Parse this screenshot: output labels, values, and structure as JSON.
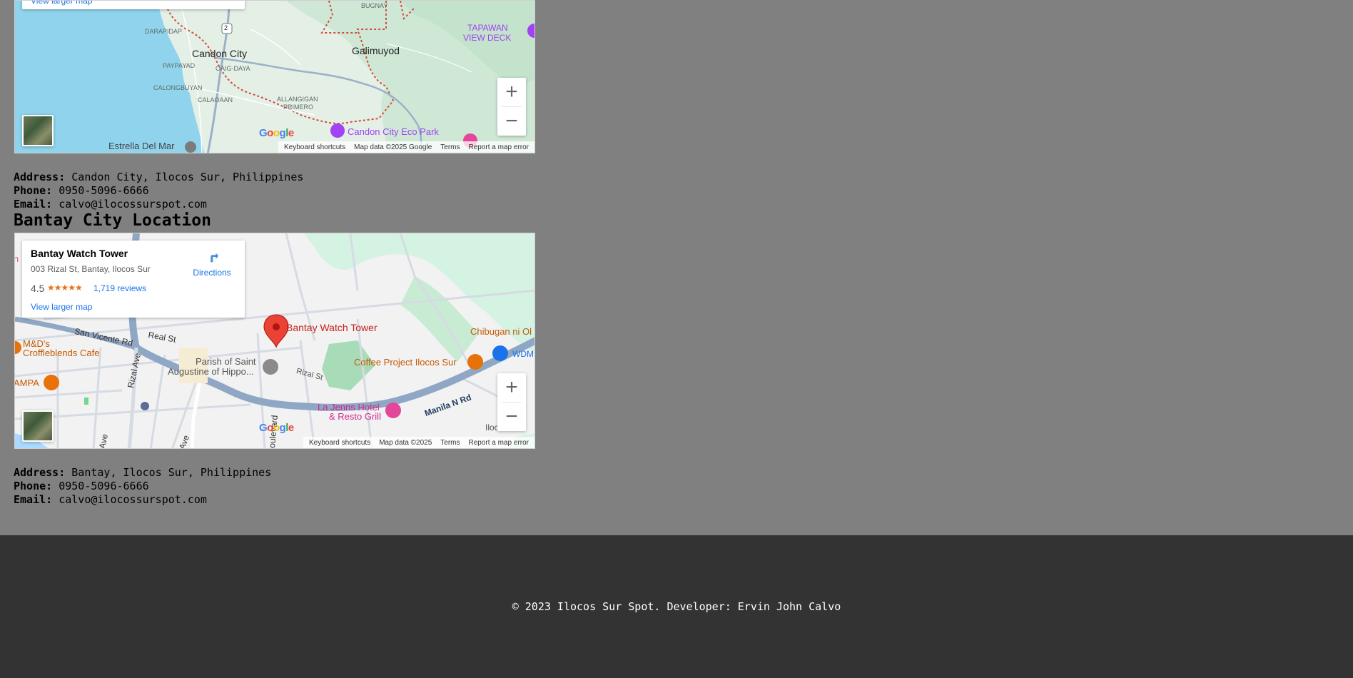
{
  "map1": {
    "larger_map_link": "View larger map",
    "labels": {
      "bugnay": "BUGNAY",
      "darapidap": "DARAPIDAP",
      "candon_city": "Candon City",
      "oaig_daya": "OAIG-DAYA",
      "paypayad": "PAYPAYAD",
      "calongbuyan": "CALONGBUYAN",
      "calaoaan": "CALAOAAN",
      "allangigan": "ALLANGIGAN",
      "primero": "PRIMERO",
      "galimuyod": "Galimuyod",
      "tapawan": "TAPAWAN",
      "view_deck": "VIEW DECK",
      "estrella": "Estrella Del Mar",
      "eco_park": "Candon City Eco Park",
      "route": "2"
    },
    "zoom_in": "+",
    "zoom_out": "−",
    "attribution": {
      "shortcuts": "Keyboard shortcuts",
      "data": "Map data ©2025 Google",
      "terms": "Terms",
      "report": "Report a map error"
    }
  },
  "candon_details": {
    "address_label": "Address:",
    "address_value": "Candon City, Ilocos Sur, Philippines",
    "phone_label": "Phone:",
    "phone_value": "0950-5096-6666",
    "email_label": "Email:",
    "email_value": "calvo@ilocossurspot.com"
  },
  "bantay_section": {
    "title": "Bantay City Location"
  },
  "map2": {
    "place_name": "Bantay Watch Tower",
    "place_address": "003 Rizal St, Bantay, Ilocos Sur",
    "rating": "4.5",
    "stars": "★★★★★",
    "reviews": "1,719 reviews",
    "directions": "Directions",
    "larger_map_link": "View larger map",
    "labels": {
      "pin_label": "Bantay Watch Tower",
      "san_vicente": "San Vicente Rd",
      "real_st": "Real St",
      "md_line1": "M&D's",
      "md_line2": "Croffleblends Cafe",
      "rizal_ave": "Rizal Ave",
      "parish_line1": "Parish of Saint",
      "parish_line2": "Augustine of Hippo...",
      "rizal_st": "Rizal St",
      "coffee_project": "Coffee Project Ilocos Sur",
      "chibugan": "Chibugan ni Ol",
      "wdm": "WDM",
      "ampa": "AMPA",
      "la_jenns1": "La Jenns Hotel",
      "la_jenns2": "& Resto Grill",
      "manila_rd": "Manila N Rd",
      "ilocos": "Ilocos",
      "ave1": "Ave",
      "ave2": "Ave",
      "oulevard": "oulevard",
      "n_edge": "n"
    },
    "zoom_in": "+",
    "zoom_out": "−",
    "attribution": {
      "shortcuts": "Keyboard shortcuts",
      "data": "Map data ©2025",
      "terms": "Terms",
      "report": "Report a map error"
    }
  },
  "bantay_details": {
    "address_label": "Address:",
    "address_value": "Bantay, Ilocos Sur, Philippines",
    "phone_label": "Phone:",
    "phone_value": "0950-5096-6666",
    "email_label": "Email:",
    "email_value": "calvo@ilocossurspot.com"
  },
  "footer": {
    "text": "© 2023 Ilocos Sur Spot. Developer: Ervin John Calvo"
  },
  "colors": {
    "page_bg": "#808080",
    "footer_bg": "#333333",
    "sea": "#8fd4ec",
    "land": "#e0f0e6",
    "poi_purple": "#a142f4",
    "poi_orange": "#e8710a",
    "pin_red": "#ea4335",
    "link_blue": "#1a73e8"
  }
}
